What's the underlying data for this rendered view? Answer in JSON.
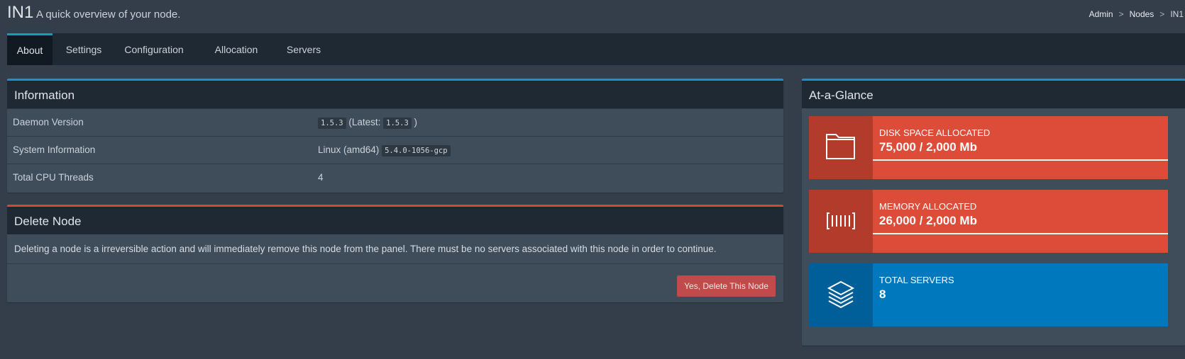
{
  "header": {
    "title": "IN1",
    "subtitle": "A quick overview of your node.",
    "breadcrumb": [
      "Admin",
      "Nodes",
      "IN1"
    ],
    "separator": ">"
  },
  "tabs": [
    {
      "label": "About",
      "active": true
    },
    {
      "label": "Settings",
      "active": false
    },
    {
      "label": "Configuration",
      "active": false
    },
    {
      "label": "Allocation",
      "active": false
    },
    {
      "label": "Servers",
      "active": false
    }
  ],
  "information": {
    "title": "Information",
    "rows": [
      {
        "label": "Daemon Version",
        "code1": "1.5.3",
        "text_before": "(Latest: ",
        "code2": "1.5.3",
        "text_after": ")"
      },
      {
        "label": "System Information",
        "text": "Linux (amd64)",
        "code": "5.4.0-1056-gcp"
      },
      {
        "label": "Total CPU Threads",
        "value": "4"
      }
    ]
  },
  "delete_node": {
    "title": "Delete Node",
    "description": "Deleting a node is a irreversible action and will immediately remove this node from the panel. There must be no servers associated with this node in order to continue.",
    "button_label": "Yes, Delete This Node"
  },
  "at_a_glance": {
    "title": "At-a-Glance",
    "stats": [
      {
        "label": "DISK SPACE ALLOCATED",
        "value": "75,000 / 2,000 Mb",
        "icon": "folder-icon",
        "color": "#dd4b39",
        "progress": 1.0
      },
      {
        "label": "MEMORY ALLOCATED",
        "value": "26,000 / 2,000 Mb",
        "icon": "memory-icon",
        "color": "#dd4b39",
        "progress": 1.0
      },
      {
        "label": "TOTAL SERVERS",
        "value": "8",
        "icon": "layers-icon",
        "color": "#0078be"
      }
    ]
  },
  "colors": {
    "background": "#343e4b",
    "tab_bar": "#1f2933",
    "tab_active_border": "#14a0ad",
    "info_accent": "#1f8fc9",
    "danger_accent": "#d14a32",
    "danger_button": "#c14a4a",
    "stat_red": "#dd4b39",
    "stat_blue": "#0078be"
  }
}
